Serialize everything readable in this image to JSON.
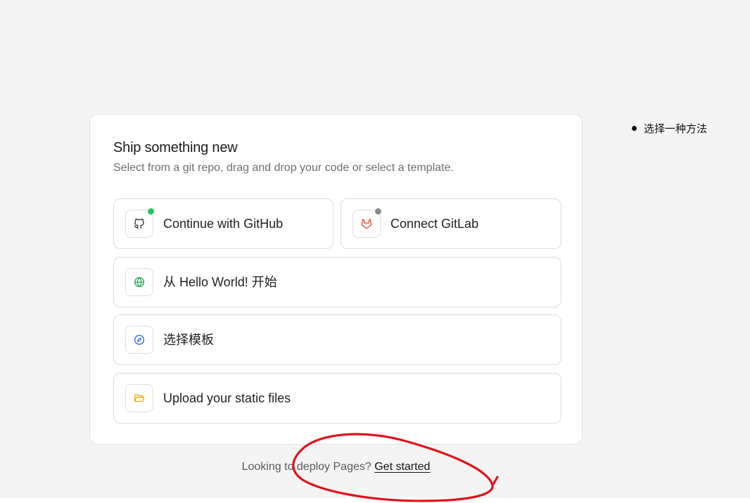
{
  "card": {
    "title": "Ship something new",
    "subtitle": "Select from a git repo, drag and drop your code or select a template."
  },
  "options": [
    {
      "label": "Continue with GitHub",
      "icon": "github-icon",
      "status_color": "#22c55e"
    },
    {
      "label": "Connect GitLab",
      "icon": "gitlab-icon",
      "status_color": "#8a8a8a"
    },
    {
      "label": "从 Hello World! 开始",
      "icon": "globe-icon"
    },
    {
      "label": "选择模板",
      "icon": "compass-icon"
    },
    {
      "label": "Upload your static files",
      "icon": "folder-icon"
    }
  ],
  "side_legend": {
    "label": "选择一种方法"
  },
  "footer": {
    "prompt": "Looking to deploy Pages?",
    "link": "Get started"
  },
  "colors": {
    "page_background": "#f4f4f4",
    "annotation_stroke": "#e0131b",
    "gitlab_orange": "#e24329",
    "globe_green": "#16a34a",
    "compass_blue": "#2563eb",
    "folder_yellow": "#f0a500"
  }
}
